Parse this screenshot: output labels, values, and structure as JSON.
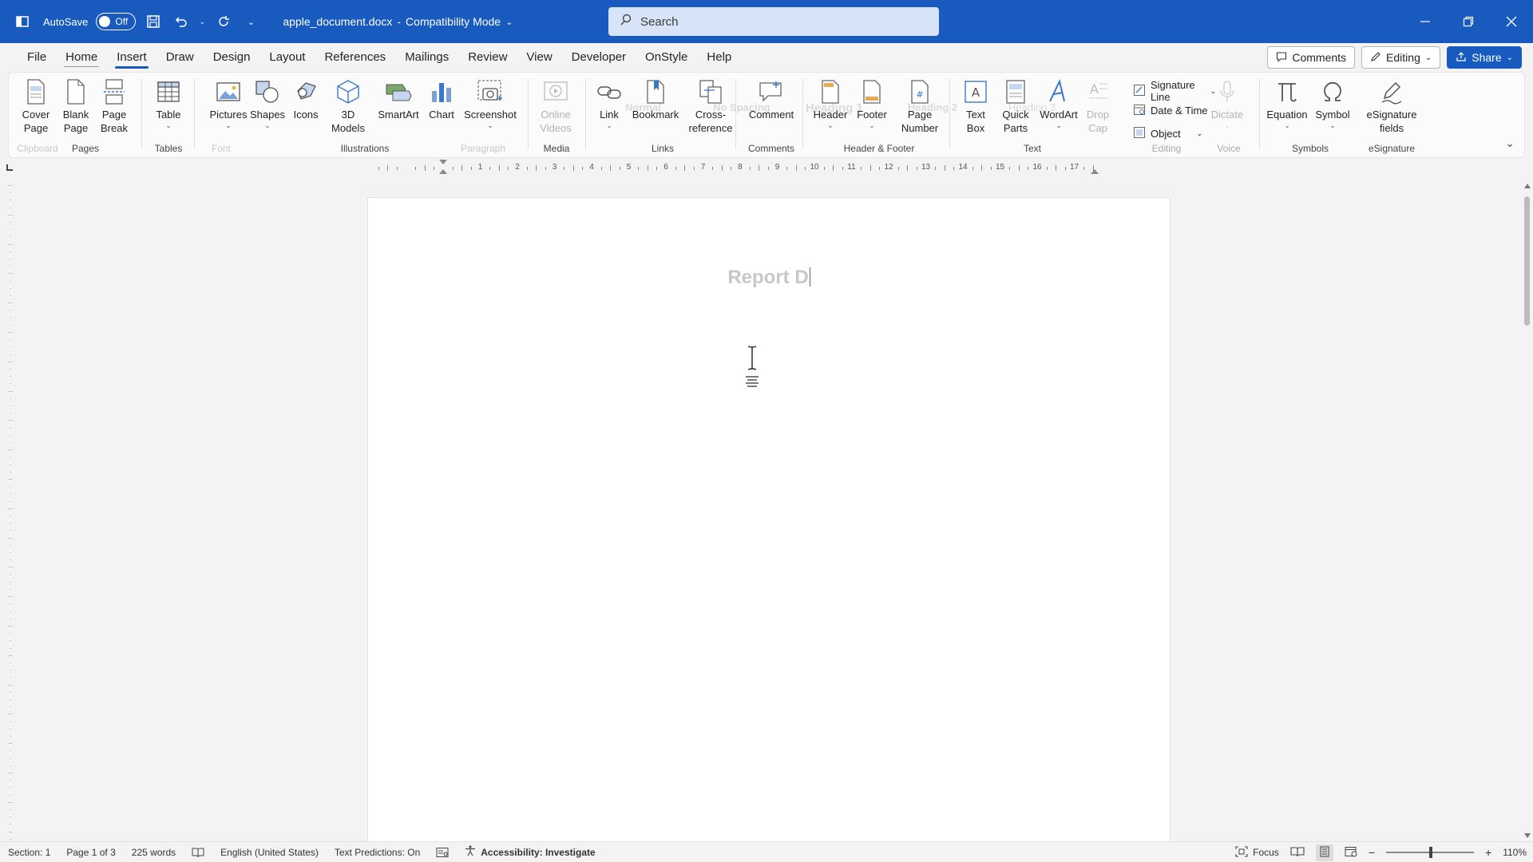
{
  "titlebar": {
    "autosave_label": "AutoSave",
    "autosave_state": "Off",
    "doc_name": "apple_document.docx",
    "separator": "-",
    "mode": "Compatibility Mode",
    "search_placeholder": "Search"
  },
  "menu": {
    "tabs": [
      "File",
      "Home",
      "Insert",
      "Draw",
      "Design",
      "Layout",
      "References",
      "Mailings",
      "Review",
      "View",
      "Developer",
      "OnStyle",
      "Help"
    ],
    "active_tab": "Insert",
    "comments_label": "Comments",
    "editing_label": "Editing",
    "share_label": "Share"
  },
  "ribbon": {
    "pages": {
      "label": "Pages",
      "cover_page": "Cover\nPage",
      "blank_page": "Blank\nPage",
      "page_break": "Page\nBreak"
    },
    "tables": {
      "label": "Tables",
      "table": "Table"
    },
    "illustrations": {
      "label": "Illustrations",
      "pictures": "Pictures",
      "shapes": "Shapes",
      "icons": "Icons",
      "models": "3D\nModels",
      "smartart": "SmartArt",
      "chart": "Chart",
      "screenshot": "Screenshot"
    },
    "media": {
      "label": "Media",
      "online_videos": "Online\nVideos"
    },
    "links": {
      "label": "Links",
      "link": "Link",
      "bookmark": "Bookmark",
      "cross_reference": "Cross-\nreference"
    },
    "comments": {
      "label": "Comments",
      "comment": "Comment"
    },
    "header_footer": {
      "label": "Header & Footer",
      "header": "Header",
      "footer": "Footer",
      "page_number": "Page\nNumber"
    },
    "text": {
      "label": "Text",
      "text_box": "Text\nBox",
      "quick_parts": "Quick\nParts",
      "wordart": "WordArt",
      "drop_cap": "Drop\nCap",
      "signature_line": "Signature Line",
      "date_time": "Date & Time",
      "object": "Object"
    },
    "voice": {
      "label": "Voice",
      "dictate": "Dictate"
    },
    "editing_group_label": "Editing",
    "symbols": {
      "label": "Symbols",
      "equation": "Equation",
      "symbol": "Symbol"
    },
    "esignature": {
      "label": "eSignature",
      "fields": "eSignature\nfields"
    },
    "ghost": {
      "clipboard": "Clipboard",
      "font": "Font",
      "paragraph": "Paragraph",
      "normal": "Normal",
      "no_spacing": "No Spacing",
      "heading1": "Heading 1",
      "heading2": "Heading 2",
      "heading3": "Heading 3"
    }
  },
  "ruler": {
    "numbers": [
      "1",
      "2",
      "3",
      "4",
      "5",
      "6",
      "7",
      "8",
      "9",
      "10",
      "11",
      "12",
      "13",
      "14",
      "15",
      "16",
      "17"
    ]
  },
  "document": {
    "title_text": "Report D"
  },
  "statusbar": {
    "section": "Section: 1",
    "page": "Page 1 of 3",
    "words": "225 words",
    "language": "English (United States)",
    "text_predictions": "Text Predictions: On",
    "accessibility": "Accessibility: Investigate",
    "focus": "Focus",
    "zoom": "110%"
  },
  "colors": {
    "brand": "#185abd",
    "search_bg": "#d7e3f6"
  }
}
